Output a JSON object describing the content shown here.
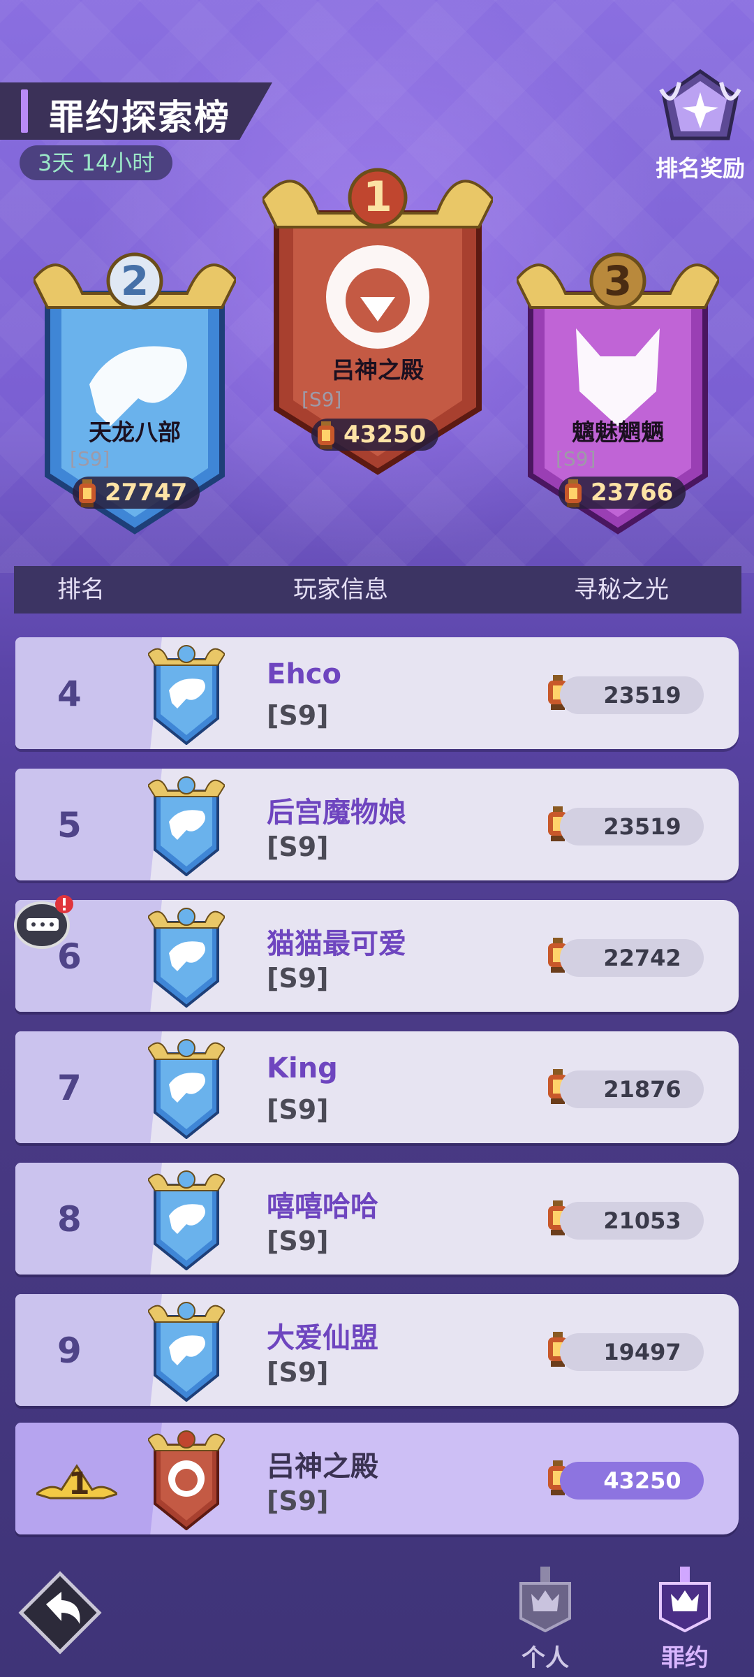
{
  "header": {
    "title": "罪约探索榜",
    "timer": "3天 14小时",
    "reward_label": "排名奖励"
  },
  "podium": {
    "first": {
      "rank": "1",
      "name": "吕神之殿",
      "server": "[S9]",
      "score": "43250"
    },
    "second": {
      "rank": "2",
      "name": "天龙八部",
      "server": "[S9]",
      "score": "27747"
    },
    "third": {
      "rank": "3",
      "name": "魑魅魍魉",
      "server": "[S9]",
      "score": "23766"
    }
  },
  "table": {
    "headers": {
      "rank": "排名",
      "player": "玩家信息",
      "score": "寻秘之光"
    },
    "rows": [
      {
        "rank": "4",
        "name": "Ehco",
        "server": "[S9]",
        "score": "23519"
      },
      {
        "rank": "5",
        "name": "后宫魔物娘",
        "server": "[S9]",
        "score": "23519"
      },
      {
        "rank": "6",
        "name": "猫猫最可爱",
        "server": "[S9]",
        "score": "22742"
      },
      {
        "rank": "7",
        "name": "King",
        "server": "[S9]",
        "score": "21876"
      },
      {
        "rank": "8",
        "name": "嘻嘻哈哈",
        "server": "[S9]",
        "score": "21053"
      },
      {
        "rank": "9",
        "name": "大爱仙盟",
        "server": "[S9]",
        "score": "19497"
      }
    ],
    "my_row": {
      "rank": "1",
      "name": "吕神之殿",
      "server": "[S9]",
      "score": "43250"
    }
  },
  "bottom_nav": {
    "personal": "个人",
    "pact": "罪约"
  },
  "colors": {
    "accent_purple": "#6e45bf",
    "gold": "#e6c36a",
    "banner_blue": "#4d9be0",
    "banner_red": "#c0554a",
    "banner_pink": "#b04fc6"
  }
}
